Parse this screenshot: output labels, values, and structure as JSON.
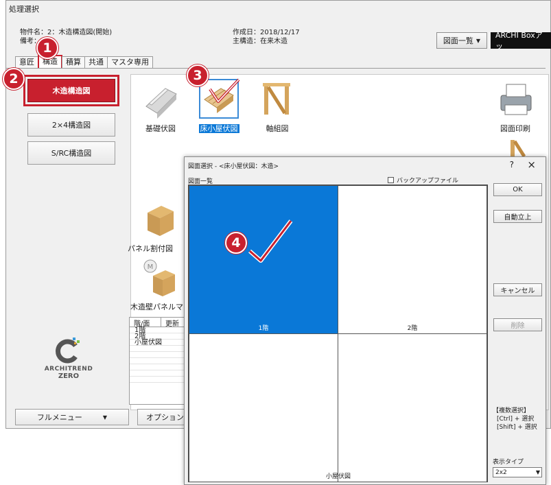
{
  "main": {
    "title": "処理選択",
    "property_line1": "物件名：2：木造構造図(開始)",
    "property_line2": "備考：",
    "date_line": "作成日：2018/12/17",
    "structure_line": "主構造：在来木造",
    "drawing_list_btn": "図面一覧",
    "archi_box_btn": "ARCHI Boxアッ"
  },
  "tabs": [
    {
      "label": "意匠",
      "active": false
    },
    {
      "label": "構造",
      "active": true
    },
    {
      "label": "積算",
      "active": false
    },
    {
      "label": "共通",
      "active": false
    },
    {
      "label": "マスタ専用",
      "active": false
    }
  ],
  "sidebar": {
    "items": [
      {
        "label": "木造構造図",
        "selected": true
      },
      {
        "label": "2×4構造図",
        "selected": false
      },
      {
        "label": "S/RC構造図",
        "selected": false
      }
    ]
  },
  "drawings": {
    "foundation": "基礎伏図",
    "floor_roof": "床小屋伏図",
    "framing": "軸組図",
    "print": "図面印刷",
    "panel": "パネル割付図",
    "wall_master": "木造壁パネルマスタ"
  },
  "floor_list": {
    "headers": [
      "階/面",
      "更新"
    ],
    "rows": [
      "1階",
      "2階",
      "小屋伏図"
    ]
  },
  "logo": {
    "line1": "ARCHITREND",
    "line2": "ZERO"
  },
  "bottom": {
    "full_menu": "フルメニュー",
    "options": "オプション"
  },
  "dialog": {
    "title": "図面選択 - <床小屋伏図：木造>",
    "help": "?",
    "close": "×",
    "list_label": "図面一覧",
    "backup_label": "バックアップファイル",
    "cells": [
      "1階",
      "2階",
      "",
      "小屋伏図"
    ],
    "ok": "OK",
    "auto": "自動立上",
    "cancel": "キャンセル",
    "delete": "削除",
    "multi_title": "【複数選択】",
    "multi_ctrl": "[Ctrl] + 選択",
    "multi_shift": "[Shift] + 選択",
    "display_type_label": "表示タイプ",
    "display_type_value": "2x2"
  },
  "steps": [
    "1",
    "2",
    "3",
    "4"
  ],
  "colors": {
    "accent": "#c8202e",
    "selected_cell": "#0a78d7"
  }
}
